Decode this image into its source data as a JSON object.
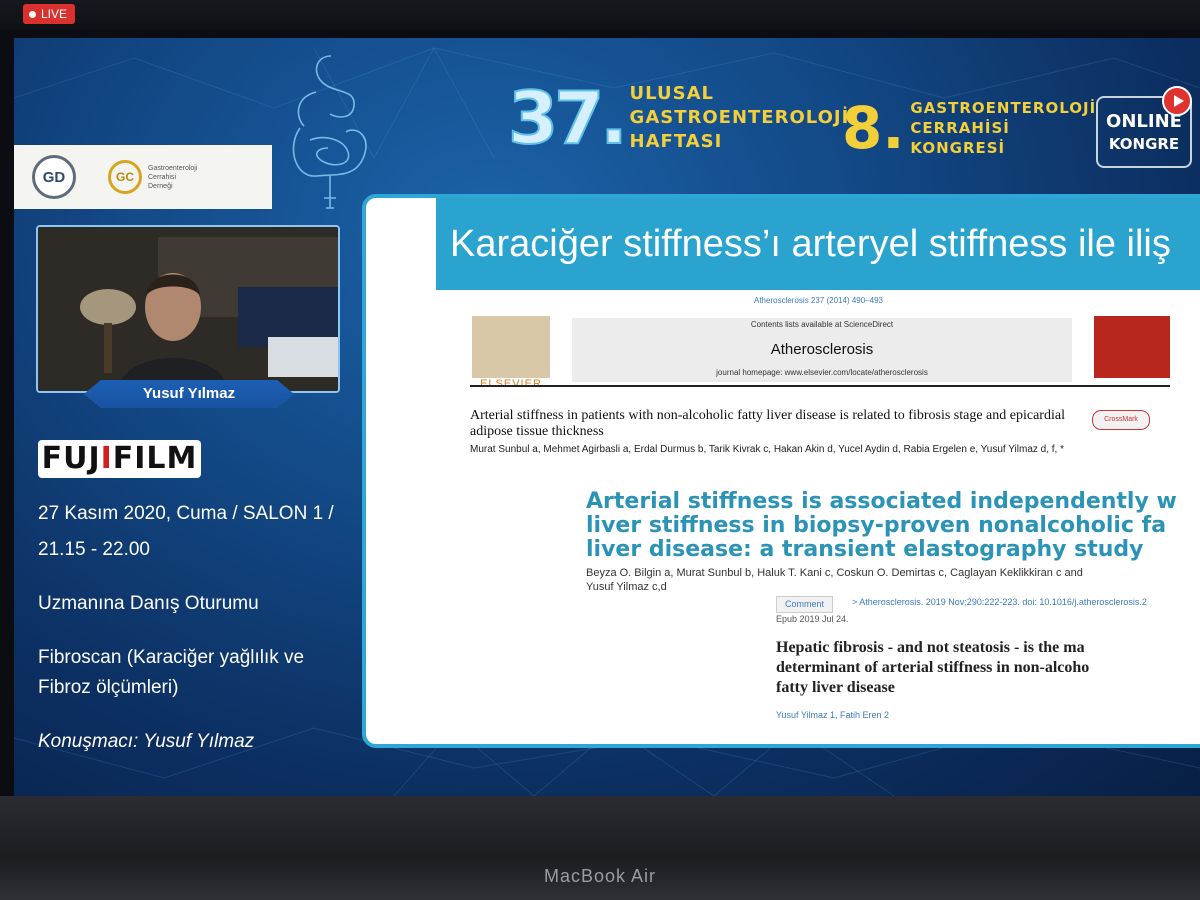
{
  "recording": {
    "live_label": "LIVE"
  },
  "header": {
    "number_37": "37.",
    "title_37": [
      "ULUSAL",
      "GASTROENTEROLOJİ",
      "HAFTASI"
    ],
    "number_8": "8.",
    "title_8": [
      "GASTROENTEROLOJİ",
      "CERRAHİSİ",
      "KONGRESİ"
    ],
    "online_label": "ONLINE",
    "kongre_label": "KONGRE"
  },
  "logos": {
    "gd_logo": "GD",
    "gc_logo": "GC",
    "gc_text": [
      "Gastroenteroloji",
      "Cerrahisi",
      "Derneği"
    ]
  },
  "speaker": {
    "name": "Yusuf Yılmaz"
  },
  "sponsor": {
    "name_part1": "FUJ",
    "name_i": "I",
    "name_part2": "FILM"
  },
  "session_info": {
    "date_line1": "27 Kasım 2020, Cuma / SALON 1 /",
    "date_line2": "21.15 - 22.00",
    "session_type": "Uzmanına Danış Oturumu",
    "topic_line1": "Fibroscan (Karaciğer yağlılık ve",
    "topic_line2": "Fibroz ölçümleri)",
    "presenter": "Konuşmacı: Yusuf Yılmaz"
  },
  "slide": {
    "title": "Karaciğer stiffness’ı arteryel stiffness ile iliş",
    "journal_cite_top": "Atherosclerosis 237 (2014) 490–493",
    "contents_line": "Contents lists available at ScienceDirect",
    "journal_name": "Atherosclerosis",
    "homepage": "journal homepage: www.elsevier.com/locate/atherosclerosis",
    "publisher": "ELSEVIER",
    "crossmark": "CrossMark",
    "article1_title": "Arterial stiffness in patients with non-alcoholic fatty liver disease is related to fibrosis stage and epicardial adipose tissue thickness",
    "article1_authors": "Murat Sunbul a, Mehmet Agirbasli a, Erdal Durmus b, Tarik Kivrak c, Hakan Akin d, Yucel Aydin d, Rabia Ergelen e, Yusuf Yilmaz d, f, *",
    "article2_title": "Arterial stiffness is associated independently w\nliver stiffness in biopsy-proven nonalcoholic fa\nliver disease: a transient elastography study",
    "article2_authors": "Beyza O. Bilgin a, Murat Sunbul b, Haluk T. Kani c, Coskun O. Demirtas c, Caglayan Keklikkiran c and\nYusuf Yilmaz c,d",
    "comment_badge": "Comment",
    "citation": "> Atherosclerosis. 2019 Nov;290:222-223. doi: 10.1016/j.atherosclerosis.2",
    "epub": "Epub 2019 Jul 24.",
    "article3_title": "Hepatic fibrosis - and not steatosis - is the ma\ndeterminant of arterial stiffness in non-alcoho\nfatty liver disease",
    "article3_authors": "Yusuf Yilmaz 1, Fatih Eren 2"
  },
  "device": {
    "label": "MacBook Air"
  },
  "colors": {
    "live": "#d9322e",
    "accent_blue": "#2aa3cf",
    "title_yellow": "#f3cf3a",
    "article_title_blue": "#2a93b6"
  }
}
